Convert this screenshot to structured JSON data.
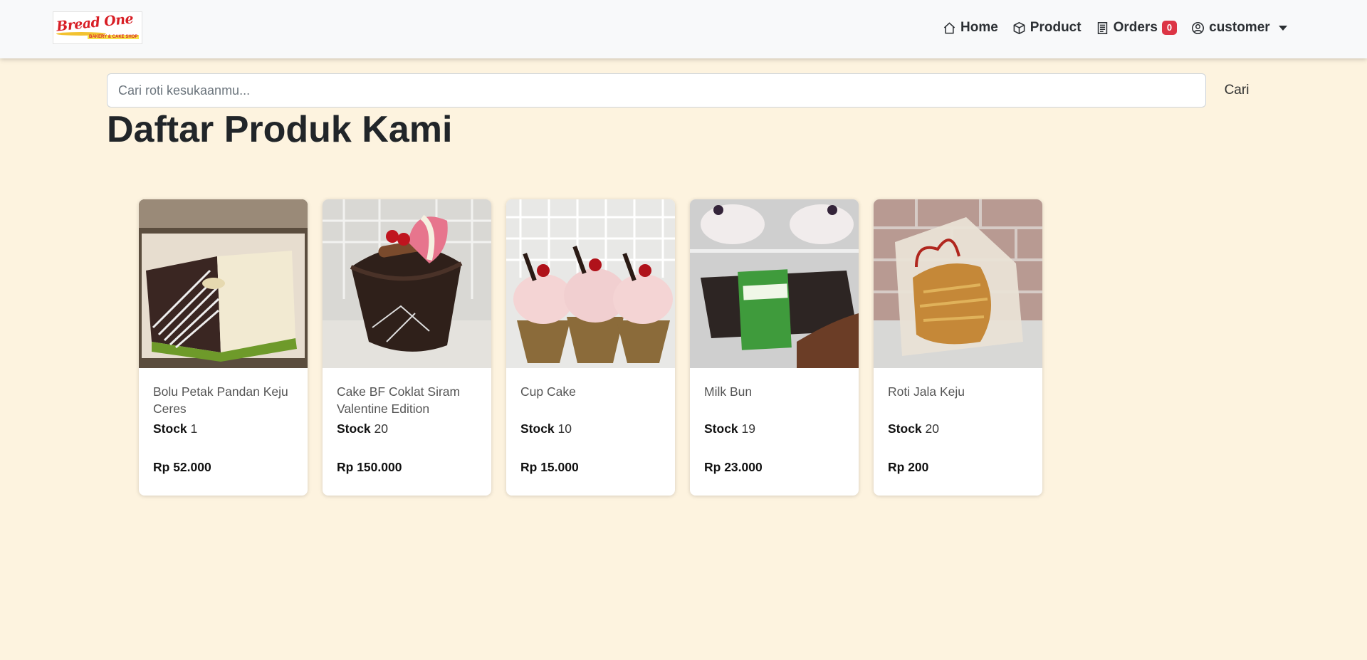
{
  "colors": {
    "page_background": "#fdf3df",
    "navbar_background": "#f8f9fa",
    "badge": "#dc3545",
    "logo_red": "#d81f26"
  },
  "navbar": {
    "logo_text": "Bread One",
    "logo_tagline": "BAKERY & CAKE SHOP",
    "items": [
      {
        "label": "Home",
        "icon": "house-icon"
      },
      {
        "label": "Product",
        "icon": "box-icon"
      },
      {
        "label": "Orders",
        "icon": "receipt-icon",
        "badge": "0"
      }
    ],
    "user": {
      "label": "customer",
      "icon": "user-circle-icon"
    }
  },
  "search": {
    "placeholder": "Cari roti kesukaanmu...",
    "value": "",
    "button_label": "Cari"
  },
  "page_title": "Daftar Produk Kami",
  "products": [
    {
      "name": "Bolu Petak Pandan Keju Ceres",
      "stock_label": "Stock",
      "stock": "1",
      "price": "Rp 52.000",
      "image": "cake-photo"
    },
    {
      "name": "Cake BF Coklat Siram Valentine Edition",
      "stock_label": "Stock",
      "stock": "20",
      "price": "Rp 150.000",
      "image": "cake-photo"
    },
    {
      "name": "Cup Cake",
      "stock_label": "Stock",
      "stock": "10",
      "price": "Rp 15.000",
      "image": "cupcake-photo"
    },
    {
      "name": "Milk Bun",
      "stock_label": "Stock",
      "stock": "19",
      "price": "Rp 23.000",
      "image": "bread-photo"
    },
    {
      "name": "Roti Jala Keju",
      "stock_label": "Stock",
      "stock": "20",
      "price": "Rp 200",
      "image": "bread-photo"
    }
  ]
}
